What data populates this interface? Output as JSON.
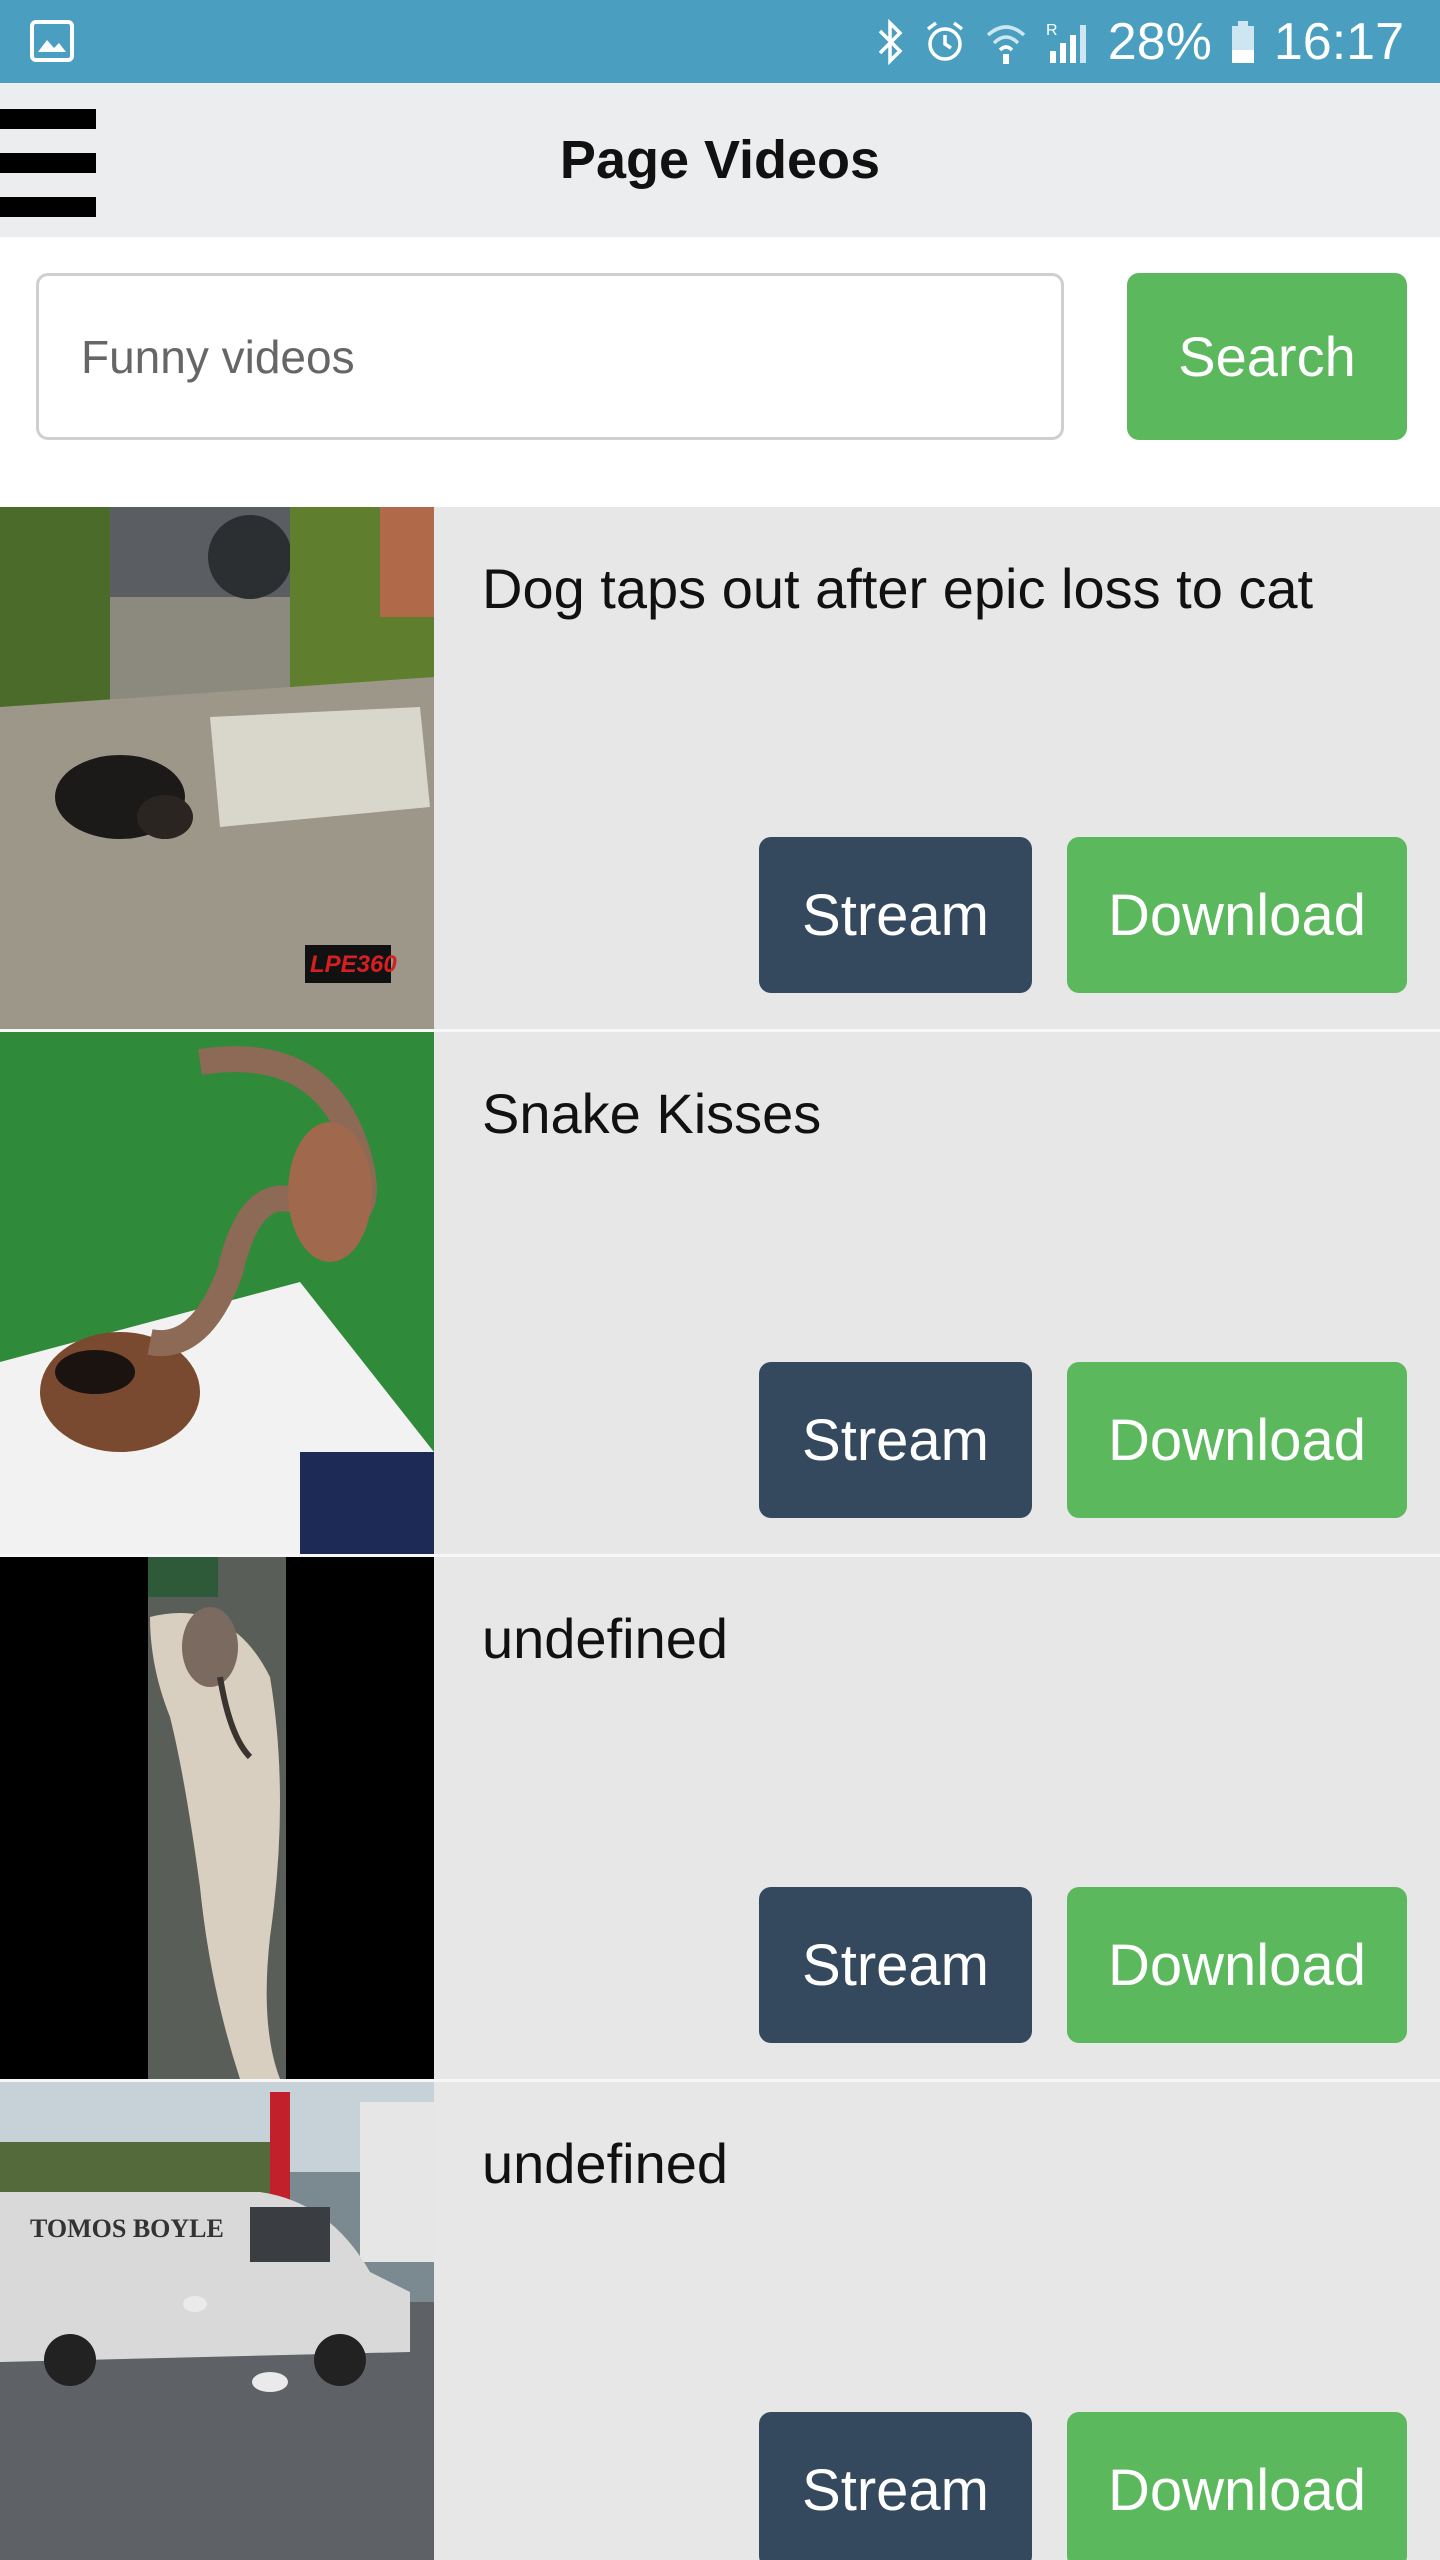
{
  "status_bar": {
    "battery": "28%",
    "time": "16:17",
    "icons": [
      "image-icon",
      "bluetooth-icon",
      "alarm-icon",
      "wifi-icon",
      "signal-icon",
      "battery-icon"
    ]
  },
  "app_bar": {
    "title": "Page Videos",
    "menu_icon": "hamburger-menu-icon"
  },
  "search": {
    "placeholder": "Funny videos",
    "button_label": "Search"
  },
  "videos": [
    {
      "title": "Dog taps out after epic loss to cat",
      "stream_label": "Stream",
      "download_label": "Download",
      "thumbnail": "dog-and-cat-thumbnail"
    },
    {
      "title": "Snake Kisses",
      "stream_label": "Stream",
      "download_label": "Download",
      "thumbnail": "snake-man-thumbnail"
    },
    {
      "title": "undefined",
      "stream_label": "Stream",
      "download_label": "Download",
      "thumbnail": "vertical-video-thumbnail"
    },
    {
      "title": "undefined",
      "stream_label": "Stream",
      "download_label": "Download",
      "thumbnail": "van-street-thumbnail"
    }
  ],
  "colors": {
    "status_bar": "#4a9fc0",
    "app_bar": "#ebedee",
    "success_green": "#5cb85c",
    "stream_navy": "#34495e",
    "list_background": "#e7e7e7"
  }
}
